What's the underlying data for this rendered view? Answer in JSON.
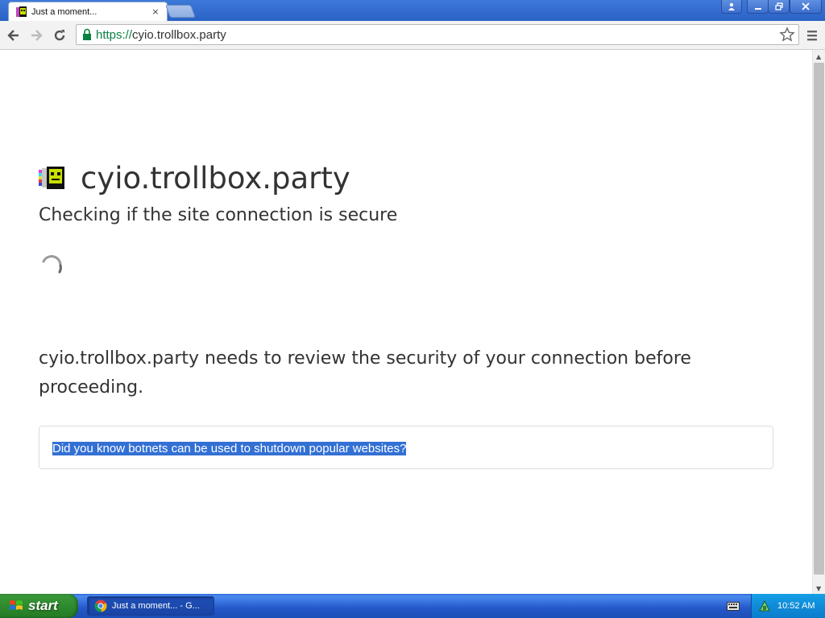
{
  "browser": {
    "tab": {
      "title": "Just a moment...",
      "close": "×"
    },
    "url": {
      "scheme": "https://",
      "rest": "cyio.trollbox.party"
    }
  },
  "page": {
    "site_name": "cyio.trollbox.party",
    "checking": "Checking if the site connection is secure",
    "review": "cyio.trollbox.party needs to review the security of your connection before proceeding.",
    "tip": "Did you know botnets can be used to shutdown popular websites?"
  },
  "taskbar": {
    "start": "start",
    "task_label": "Just a moment... - G...",
    "clock": "10:52 AM"
  },
  "icons": {
    "back": "arrow-left-icon",
    "forward": "arrow-right-icon",
    "reload": "reload-icon",
    "lock": "lock-icon",
    "star": "star-icon",
    "menu": "hamburger-menu-icon"
  },
  "colors": {
    "secure_green": "#0b8043",
    "selection_blue": "#3370d4",
    "xp_taskbar": "#245edb",
    "xp_start": "#2e8b2e"
  }
}
